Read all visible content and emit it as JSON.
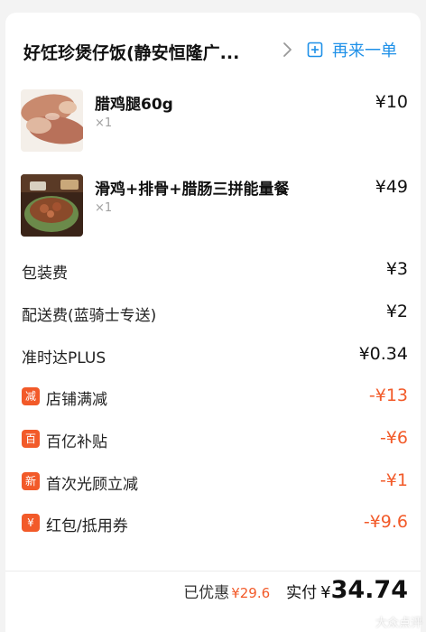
{
  "header": {
    "shop_name": "好饪珍煲仔饭(静安恒隆广...",
    "reorder_label": "再来一单",
    "accent_color": "#1e90e8"
  },
  "items": [
    {
      "name": "腊鸡腿60g",
      "qty": "×1",
      "price": "¥10",
      "image": "cured-chicken-leg-photo"
    },
    {
      "name": "滑鸡+排骨+腊肠三拼能量餐",
      "qty": "×1",
      "price": "¥49",
      "image": "claypot-rice-meal-photo"
    }
  ],
  "fees": [
    {
      "label": "包装费",
      "value": "¥3"
    },
    {
      "label": "配送费(蓝骑士专送)",
      "value": "¥2"
    },
    {
      "label": "准时达PLUS",
      "value": "¥0.34"
    }
  ],
  "discounts": [
    {
      "badge": "减",
      "label": "店铺满减",
      "value": "-¥13"
    },
    {
      "badge": "百",
      "label": "百亿补贴",
      "value": "-¥6"
    },
    {
      "badge": "新",
      "label": "首次光顾立减",
      "value": "-¥1"
    },
    {
      "badge": "¥",
      "label": "红包/抵用券",
      "value": "-¥9.6"
    }
  ],
  "summary": {
    "saved_label": "已优惠",
    "saved_amount": "¥29.6",
    "paid_label": "实付",
    "paid_symbol": "¥",
    "paid_amount": "34.74"
  },
  "watermark": "大众点评",
  "colors": {
    "discount": "#f25a29",
    "badge_bg": "#f25a29"
  }
}
